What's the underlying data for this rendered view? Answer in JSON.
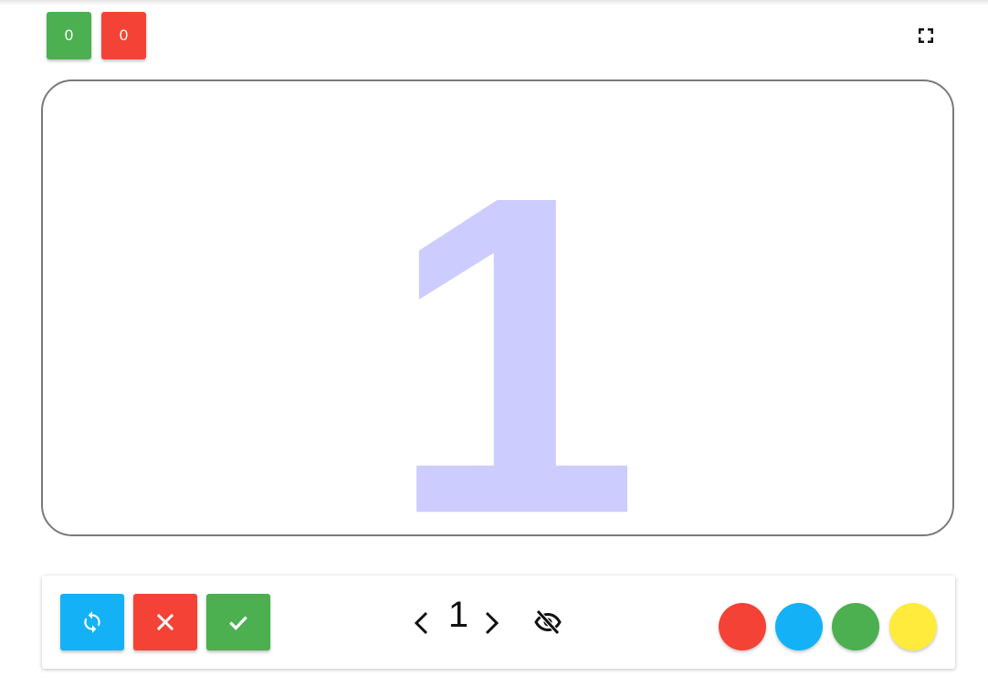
{
  "score": {
    "correct": "0",
    "wrong": "0"
  },
  "header": {
    "fullscreen_icon": "fullscreen-icon"
  },
  "card": {
    "number": "1",
    "number_color": "#ccccff"
  },
  "toolbar": {
    "reset_icon": "refresh-icon",
    "wrong_icon": "close-icon",
    "correct_icon": "check-icon",
    "prev_icon": "chevron-left-icon",
    "current_number": "1",
    "next_icon": "chevron-right-icon",
    "visibility_icon": "eye-off-icon",
    "colors": [
      "#f44336",
      "#14b1f7",
      "#4caf50",
      "#ffeb3b"
    ]
  }
}
